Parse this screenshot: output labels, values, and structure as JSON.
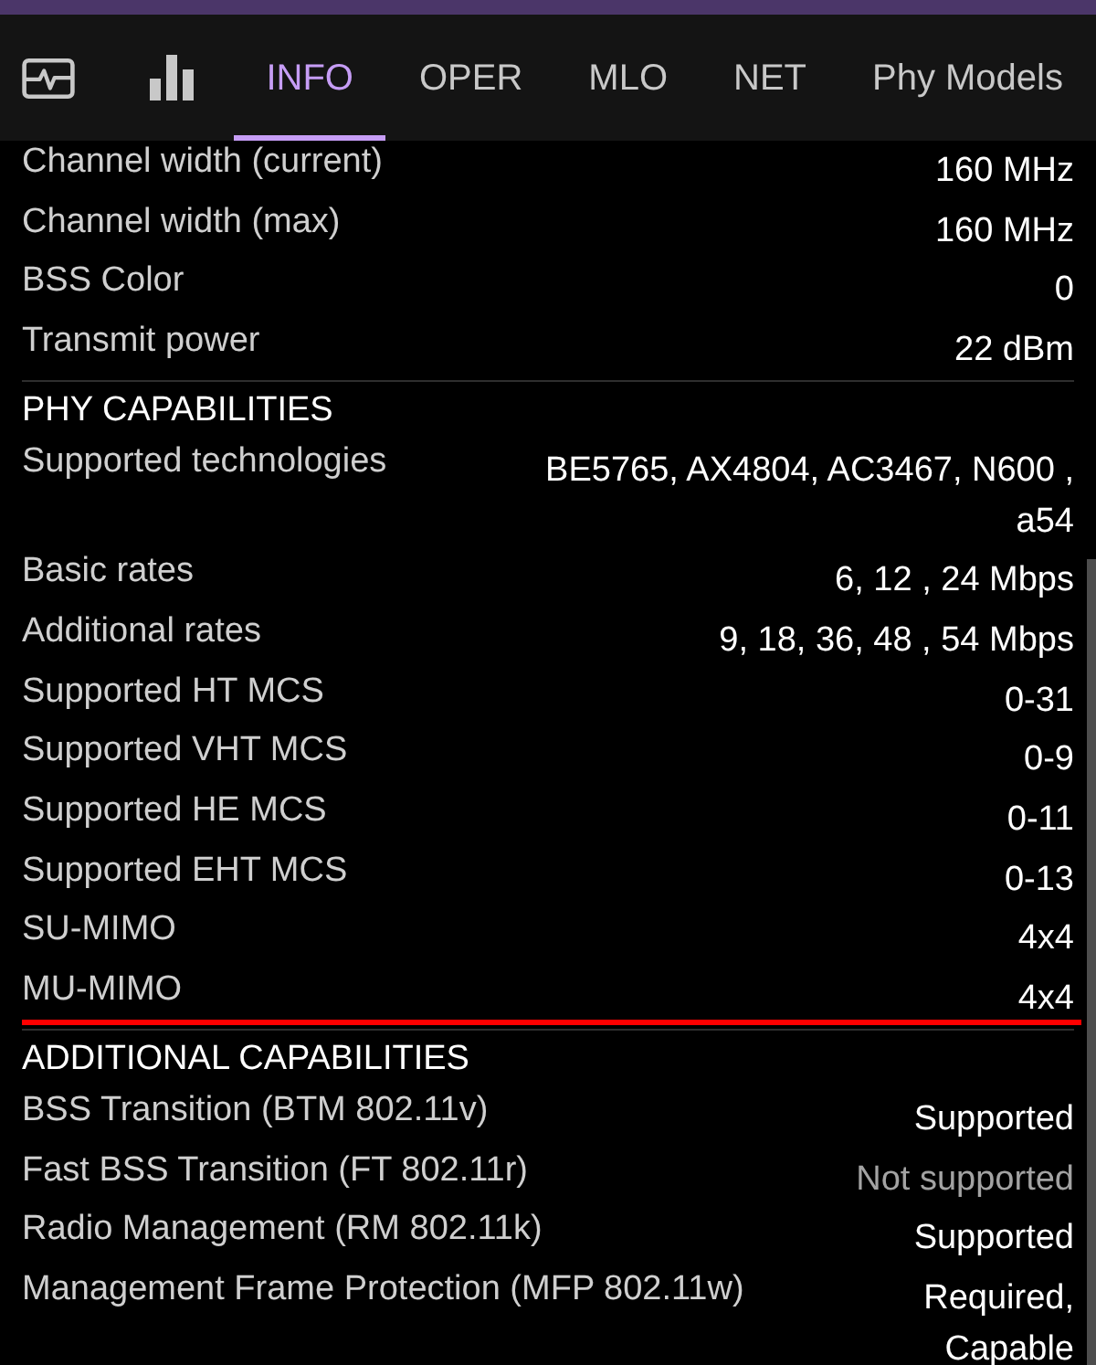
{
  "tabs": [
    {
      "kind": "monitor",
      "selected": false
    },
    {
      "kind": "chart",
      "selected": false
    },
    {
      "kind": "text",
      "label": "INFO",
      "selected": true
    },
    {
      "kind": "text",
      "label": "OPER",
      "selected": false
    },
    {
      "kind": "text",
      "label": "MLO",
      "selected": false
    },
    {
      "kind": "text",
      "label": "NET",
      "selected": false
    },
    {
      "kind": "text",
      "label": "Phy Models",
      "selected": false
    }
  ],
  "sections": [
    {
      "rows": [
        {
          "label": "Channel width (current)",
          "value": "160 MHz",
          "dimmed": false,
          "highlighted": false
        },
        {
          "label": "Channel width (max)",
          "value": "160 MHz",
          "dimmed": false,
          "highlighted": false
        },
        {
          "label": "BSS Color",
          "value": "0",
          "dimmed": false,
          "highlighted": false
        },
        {
          "label": "Transmit power",
          "value": "22 dBm",
          "dimmed": false,
          "highlighted": false
        }
      ]
    },
    {
      "title": "PHY CAPABILITIES",
      "rows": [
        {
          "label": "Supported technologies",
          "value": "BE5765, AX4804, AC3467, N600 , a54",
          "dimmed": false,
          "highlighted": false
        },
        {
          "label": "Basic rates",
          "value": "6, 12 , 24 Mbps",
          "dimmed": false,
          "highlighted": false
        },
        {
          "label": "Additional rates",
          "value": "9, 18, 36, 48 , 54 Mbps",
          "dimmed": false,
          "highlighted": false
        },
        {
          "label": "Supported HT MCS",
          "value": "0-31",
          "dimmed": false,
          "highlighted": false
        },
        {
          "label": "Supported VHT MCS",
          "value": "0-9",
          "dimmed": false,
          "highlighted": false
        },
        {
          "label": "Supported HE MCS",
          "value": "0-11",
          "dimmed": false,
          "highlighted": false
        },
        {
          "label": "Supported EHT MCS",
          "value": "0-13",
          "dimmed": false,
          "highlighted": false
        },
        {
          "label": "SU-MIMO",
          "value": "4x4",
          "dimmed": false,
          "highlighted": false
        },
        {
          "label": "MU-MIMO",
          "value": "4x4",
          "dimmed": false,
          "highlighted": true
        }
      ]
    },
    {
      "title": "ADDITIONAL CAPABILITIES",
      "rows": [
        {
          "label": "BSS Transition (BTM 802.11v)",
          "value": "Supported",
          "dimmed": false,
          "highlighted": false
        },
        {
          "label": "Fast BSS Transition (FT 802.11r)",
          "value": "Not supported",
          "dimmed": true,
          "highlighted": false
        },
        {
          "label": "Radio Management (RM 802.11k)",
          "value": "Supported",
          "dimmed": false,
          "highlighted": false
        },
        {
          "label": "Management Frame Protection (MFP 802.11w)",
          "value": "Required, Capable",
          "dimmed": false,
          "highlighted": false
        }
      ]
    }
  ]
}
